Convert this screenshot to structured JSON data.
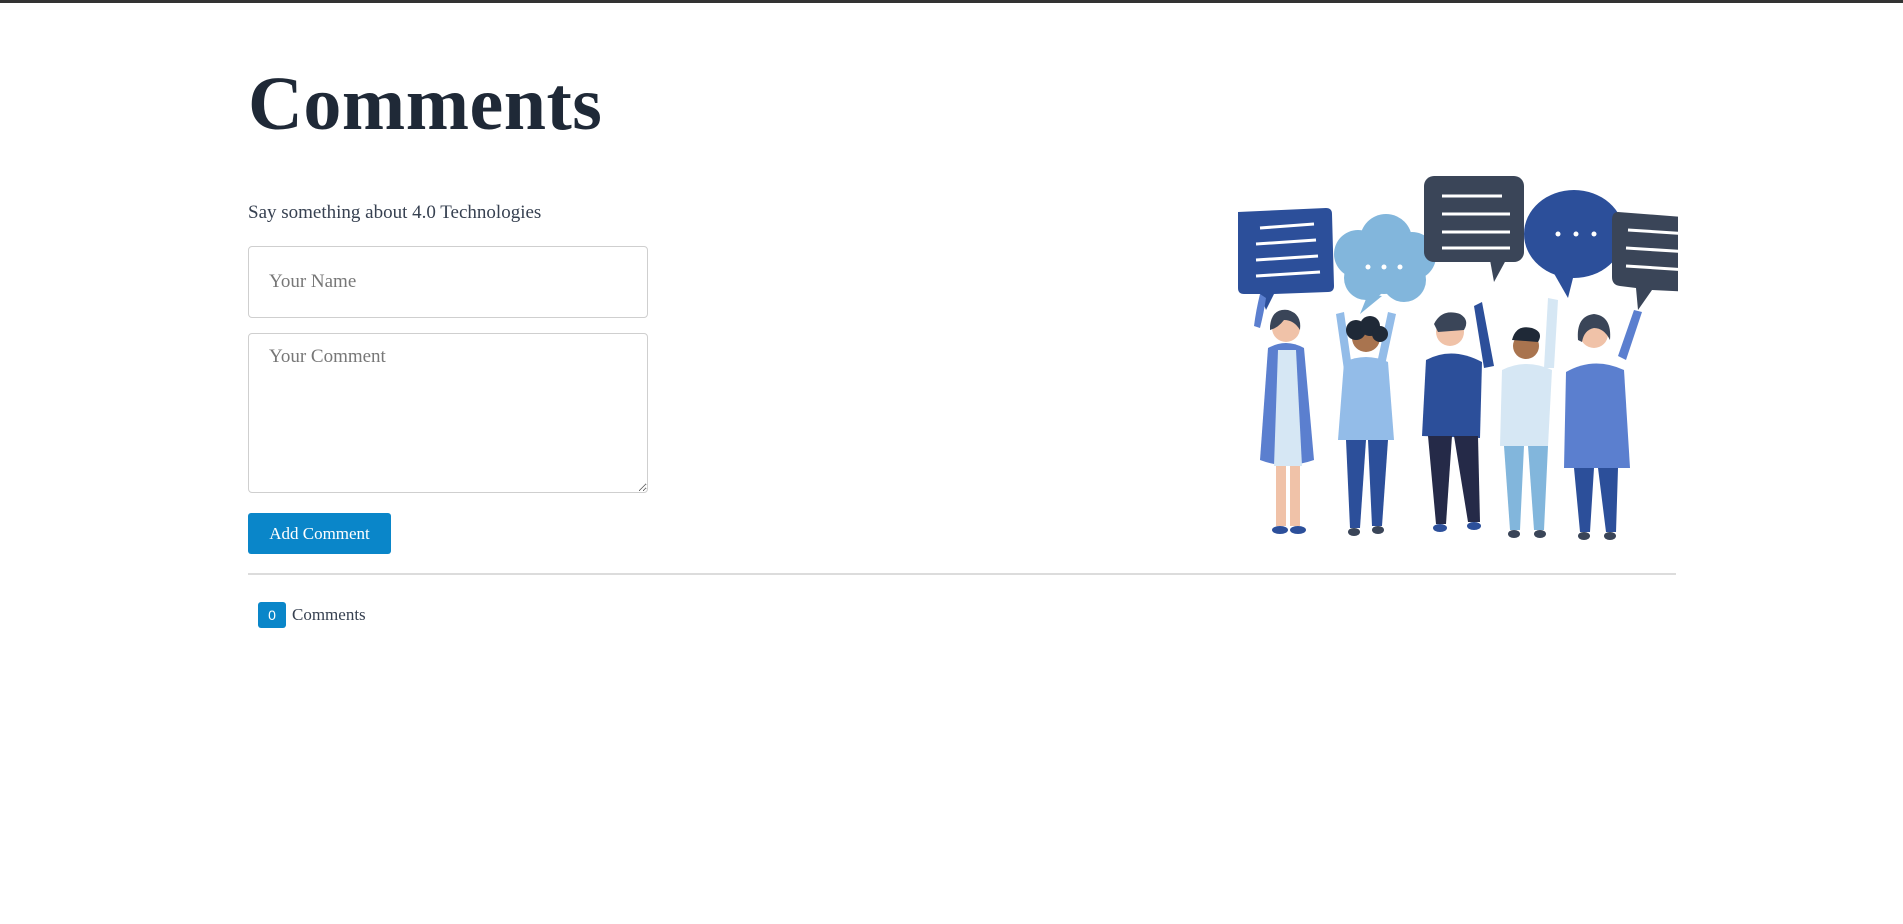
{
  "page": {
    "title": "Comments",
    "subtitle": "Say something about 4.0 Technologies"
  },
  "form": {
    "name_placeholder": "Your Name",
    "comment_placeholder": "Your Comment",
    "submit_label": "Add Comment"
  },
  "comments": {
    "count": "0",
    "label": "Comments"
  },
  "illustration": {
    "icon": "people-with-speech-bubbles-illustration",
    "colors": {
      "dark_blue": "#2c4f9a",
      "light_blue": "#82b6dc",
      "slate": "#3a4558",
      "royal_blue": "#5b7fcf",
      "pale_blue": "#d6e7f4"
    }
  },
  "colors": {
    "accent": "#0a86c9",
    "title": "#1f2937",
    "text": "#374151"
  }
}
